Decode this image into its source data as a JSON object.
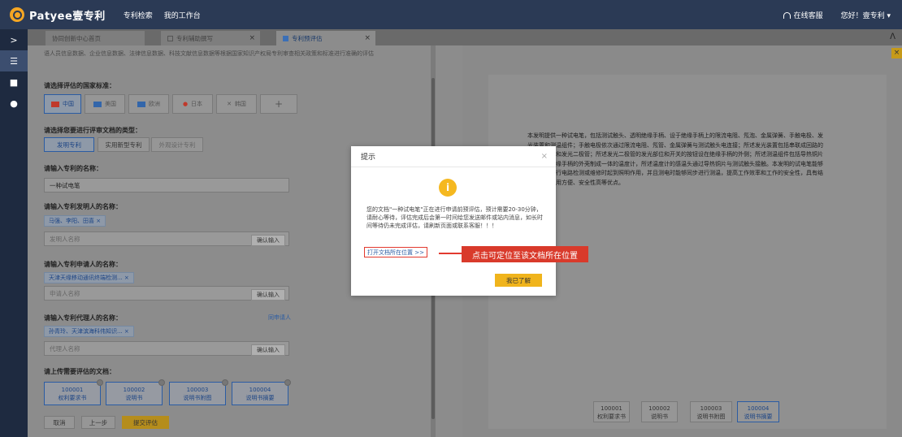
{
  "header": {
    "logo_text": "Patyee壹专利",
    "nav": [
      "专利检索",
      "我的工作台"
    ],
    "service": "在线客服",
    "user": "您好！壹专利 ▾"
  },
  "rail": {
    "items": [
      ">",
      "☰",
      "■",
      "●"
    ]
  },
  "tabs": [
    {
      "label": "协同创新中心首页",
      "close": ""
    },
    {
      "label": "专利辅助撰写",
      "close": "×"
    },
    {
      "label": "专利预评估",
      "close": "×"
    }
  ],
  "tab_collapse": "ᐱ",
  "form": {
    "intro": "语人员信息数据、企业信息数据、法律信息数据、科技文献信息数据等根据国家知识产权局专利审查相关政策和标准进行准确的评估",
    "country_label": "请选择评估的国家标准：",
    "countries": [
      "中国",
      "美国",
      "欧洲",
      "日本",
      "韩国",
      "+"
    ],
    "country_colors": [
      "#c0392b",
      "#3366aa",
      "#3366aa",
      "#c0392b",
      "#555555",
      ""
    ],
    "type_label": "请选择您要进行评审文档的类型：",
    "types": [
      "发明专利",
      "实用新型专利",
      "外观设计专利"
    ],
    "name_label": "请输入专利的名称：",
    "name_value": "一种试电笔",
    "inventor_label": "请输入专利发明人的名称：",
    "inventor_chip": "马强、李阳、田喜 ×",
    "inventor_placeholder": "发明人名称",
    "confirm": "确认输入",
    "applicant_label": "请输入专利申请人的名称：",
    "applicant_chip": "天津天缘移动通讯终端检测... ×",
    "applicant_placeholder": "申请人名称",
    "agent_label": "请输入专利代理人的名称：",
    "same_as_applicant": "同申请人",
    "agent_chip": "孙青玲、天津滨海科伟知识... ×",
    "agent_placeholder": "代理人名称",
    "upload_label": "请上传需要评估的文档：",
    "docs": [
      {
        "code": "100001",
        "name": "权利要求书"
      },
      {
        "code": "100002",
        "name": "说明书"
      },
      {
        "code": "100003",
        "name": "说明书附图"
      },
      {
        "code": "100004",
        "name": "说明书摘要"
      }
    ],
    "cancel": "取消",
    "prev": "上一步",
    "submit": "提交评估"
  },
  "preview": {
    "text": "本发明提供一种试电笔，包括测试触头、透明绝缘手柄、设于绝缘手柄上的限流电阻、氖泡、金属弹簧、手触电极、发光装置和测温组件；手触电极依次通过限流电阻、氖管、金属弹簧与测试触头电连接；所述发光装置包括串联成回路的电池、开关和发光二极管；所述发光二极管的发光部位和开关的按钮设在绝缘手柄的外侧；所述测温组件包括导热铜片和与透明绝缘手柄的外壳制成一体的温度计，所述温度计的感温头通过导热铜片与测试触头接触。本发明的试电笔能够在黑暗中进行电路检测或维修时起到照明作用，并且测电时能够同步进行测温，提高工作效率和工作的安全性，具有结构简单、使用方便、安全性高等优点。",
    "docs": [
      {
        "code": "100001",
        "name": "权利要求书"
      },
      {
        "code": "100002",
        "name": "说明书"
      },
      {
        "code": "100003",
        "name": "说明书附图"
      },
      {
        "code": "100004",
        "name": "说明书摘要"
      }
    ],
    "close_x": "×"
  },
  "dialog": {
    "title": "提示",
    "close": "×",
    "icon": "i",
    "message": "您的文档\"一种试电笔\"正在进行申请前预评估，预计需要20-30分钟，请耐心等待，评估完成后会第一时间给您发送邮件或站内消息，如长时间等待仍未完成评估，请刷新页面或联系客服！！！",
    "link": "打开文档所在位置 >>",
    "ok": "我已了解"
  },
  "annotation": {
    "text": "点击可定位至该文档所在位置"
  }
}
